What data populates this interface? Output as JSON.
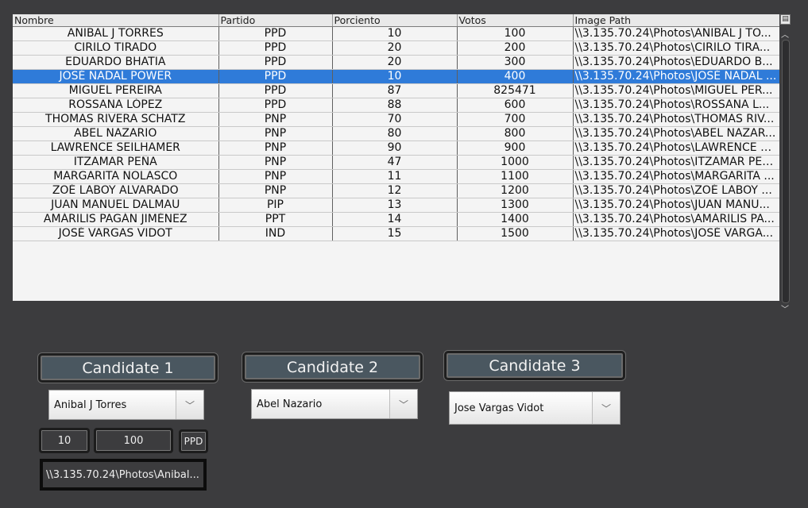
{
  "table": {
    "columns": [
      "Nombre",
      "Partido",
      "Porciento",
      "Votos",
      "Image Path"
    ],
    "rows": [
      [
        "ANIBAL J TORRES",
        "PPD",
        "10",
        "100",
        "\\\\3.135.70.24\\Photos\\ANIBAL J TO..."
      ],
      [
        "CIRILO TIRADO",
        "PPD",
        "20",
        "200",
        "\\\\3.135.70.24\\Photos\\CIRILO TIRA..."
      ],
      [
        "EDUARDO BHATIA",
        "PPD",
        "20",
        "300",
        "\\\\3.135.70.24\\Photos\\EDUARDO B..."
      ],
      [
        "JOSÉ NADAL POWER",
        "PPD",
        "10",
        "400",
        "\\\\3.135.70.24\\Photos\\JOSÉ NADAL ..."
      ],
      [
        "MIGUEL PEREIRA",
        "PPD",
        "87",
        "825471",
        "\\\\3.135.70.24\\Photos\\MIGUEL PER..."
      ],
      [
        "ROSSANA LÓPEZ",
        "PPD",
        "88",
        "600",
        "\\\\3.135.70.24\\Photos\\ROSSANA L..."
      ],
      [
        "THOMAS RIVERA SCHATZ",
        "PNP",
        "70",
        "700",
        "\\\\3.135.70.24\\Photos\\THOMAS RIV..."
      ],
      [
        "ABEL NAZARIO",
        "PNP",
        "80",
        "800",
        "\\\\3.135.70.24\\Photos\\ABEL NAZAR..."
      ],
      [
        "LAWRENCE SEILHAMER",
        "PNP",
        "90",
        "900",
        "\\\\3.135.70.24\\Photos\\LAWRENCE S..."
      ],
      [
        "ITZAMAR PEÑA",
        "PNP",
        "47",
        "1000",
        "\\\\3.135.70.24\\Photos\\ITZAMAR PER..."
      ],
      [
        "MARGARITA NOLASCO",
        "PNP",
        "11",
        "1100",
        "\\\\3.135.70.24\\Photos\\MARGARITA ..."
      ],
      [
        "ZOÉ LABOY ALVARADO",
        "PNP",
        "12",
        "1200",
        "\\\\3.135.70.24\\Photos\\ZOÉ LABOY ..."
      ],
      [
        "JUAN MANUEL DALMAU",
        "PIP",
        "13",
        "1300",
        "\\\\3.135.70.24\\Photos\\JUAN MANU..."
      ],
      [
        "AMÁRILIS PAGÁN JIMÉNEZ",
        "PPT",
        "14",
        "1400",
        "\\\\3.135.70.24\\Photos\\AMÁRILIS PA..."
      ],
      [
        "JOSÉ VARGAS VIDOT",
        "IND",
        "15",
        "1500",
        "\\\\3.135.70.24\\Photos\\JOSÉ VARGA..."
      ]
    ],
    "selected_row": 3,
    "selection_color": "#2f7bd9"
  },
  "candidates": [
    {
      "button_label": "Candidate 1",
      "selected_name": "Anibal J Torres",
      "porciento": "10",
      "votos": "100",
      "partido": "PPD",
      "image_path": "\\\\3.135.70.24\\Photos\\Anibal..."
    },
    {
      "button_label": "Candidate 2",
      "selected_name": "Abel Nazario"
    },
    {
      "button_label": "Candidate 3",
      "selected_name": "Jose Vargas Vidot"
    }
  ]
}
